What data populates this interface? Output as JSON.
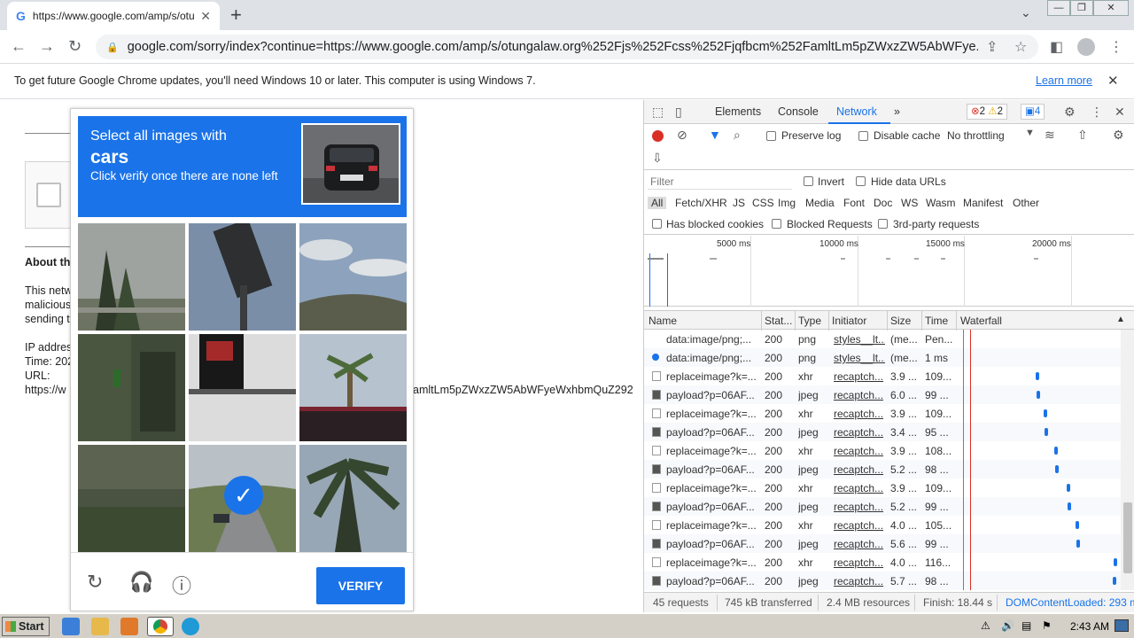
{
  "tab": {
    "title": "https://www.google.com/amp/s/otu",
    "favicon": "G"
  },
  "toolbar": {
    "url": "google.com/sorry/index?continue=https://www.google.com/amp/s/otungalaw.org%252Fjs%252Fcss%252Fjqfbcm%252FamltLm5pZWxzZW5AbWFye..."
  },
  "infobar": {
    "message": "To get future Google Chrome updates, you'll need Windows 10 or later. This computer is using Windows 7.",
    "learn_more": "Learn more"
  },
  "page": {
    "about_heading": "About th",
    "para1": "This netw",
    "para2": "malicious",
    "para3": "sending t",
    "ip_label": "IP addres",
    "time_label": "Time: 202",
    "url_label": "URL:",
    "url_value": "https://w",
    "url_tail": "amltLm5pZWxzZW5AbWFyeWxhbmQuZ292"
  },
  "captcha": {
    "line1": "Select all images with",
    "target": "cars",
    "line3": "Click verify once there are none left",
    "verify_label": "VERIFY",
    "selected_tile": 7
  },
  "devtools": {
    "tabs": [
      "Elements",
      "Console",
      "Network"
    ],
    "active_tab": "Network",
    "errors": "2",
    "warnings": "2",
    "messages": "4",
    "preserve_log": "Preserve log",
    "disable_cache": "Disable cache",
    "throttling": "No throttling",
    "filter_placeholder": "Filter",
    "invert": "Invert",
    "hide_data_urls": "Hide data URLs",
    "filter_types": [
      "All",
      "Fetch/XHR",
      "JS",
      "CSS",
      "Img",
      "Media",
      "Font",
      "Doc",
      "WS",
      "Wasm",
      "Manifest",
      "Other"
    ],
    "has_blocked_cookies": "Has blocked cookies",
    "blocked_requests": "Blocked Requests",
    "third_party": "3rd-party requests",
    "timeline_labels": [
      "5000 ms",
      "10000 ms",
      "15000 ms",
      "20000 ms"
    ],
    "columns": [
      "Name",
      "Stat...",
      "Type",
      "Initiator",
      "Size",
      "Time",
      "Waterfall"
    ],
    "rows": [
      {
        "name": "data:image/png;...",
        "status": "200",
        "type": "png",
        "initiator": "styles__lt...",
        "size": "(me...",
        "time": "Pen...",
        "icon": "none"
      },
      {
        "name": "data:image/png;...",
        "status": "200",
        "type": "png",
        "initiator": "styles__lt...",
        "size": "(me...",
        "time": "1 ms",
        "icon": "dot"
      },
      {
        "name": "replaceimage?k=...",
        "status": "200",
        "type": "xhr",
        "initiator": "recaptch...",
        "size": "3.9 ...",
        "time": "109...",
        "icon": "doc"
      },
      {
        "name": "payload?p=06AF...",
        "status": "200",
        "type": "jpeg",
        "initiator": "recaptch...",
        "size": "6.0 ...",
        "time": "99 ...",
        "icon": "img"
      },
      {
        "name": "replaceimage?k=...",
        "status": "200",
        "type": "xhr",
        "initiator": "recaptch...",
        "size": "3.9 ...",
        "time": "109...",
        "icon": "doc"
      },
      {
        "name": "payload?p=06AF...",
        "status": "200",
        "type": "jpeg",
        "initiator": "recaptch...",
        "size": "3.4 ...",
        "time": "95 ...",
        "icon": "img"
      },
      {
        "name": "replaceimage?k=...",
        "status": "200",
        "type": "xhr",
        "initiator": "recaptch...",
        "size": "3.9 ...",
        "time": "108...",
        "icon": "doc"
      },
      {
        "name": "payload?p=06AF...",
        "status": "200",
        "type": "jpeg",
        "initiator": "recaptch...",
        "size": "5.2 ...",
        "time": "98 ...",
        "icon": "img"
      },
      {
        "name": "replaceimage?k=...",
        "status": "200",
        "type": "xhr",
        "initiator": "recaptch...",
        "size": "3.9 ...",
        "time": "109...",
        "icon": "doc"
      },
      {
        "name": "payload?p=06AF...",
        "status": "200",
        "type": "jpeg",
        "initiator": "recaptch...",
        "size": "5.2 ...",
        "time": "99 ...",
        "icon": "img"
      },
      {
        "name": "replaceimage?k=...",
        "status": "200",
        "type": "xhr",
        "initiator": "recaptch...",
        "size": "4.0 ...",
        "time": "105...",
        "icon": "doc"
      },
      {
        "name": "payload?p=06AF...",
        "status": "200",
        "type": "jpeg",
        "initiator": "recaptch...",
        "size": "5.6 ...",
        "time": "99 ...",
        "icon": "img"
      },
      {
        "name": "replaceimage?k=...",
        "status": "200",
        "type": "xhr",
        "initiator": "recaptch...",
        "size": "4.0 ...",
        "time": "116...",
        "icon": "doc"
      },
      {
        "name": "payload?p=06AF...",
        "status": "200",
        "type": "jpeg",
        "initiator": "recaptch...",
        "size": "5.7 ...",
        "time": "98 ...",
        "icon": "img"
      }
    ],
    "status": {
      "requests": "45 requests",
      "transferred": "745 kB transferred",
      "resources": "2.4 MB resources",
      "finish": "Finish: 18.44 s",
      "dcl": "DOMContentLoaded: 293 ms"
    }
  },
  "taskbar": {
    "start": "Start",
    "clock": "2:43 AM"
  }
}
